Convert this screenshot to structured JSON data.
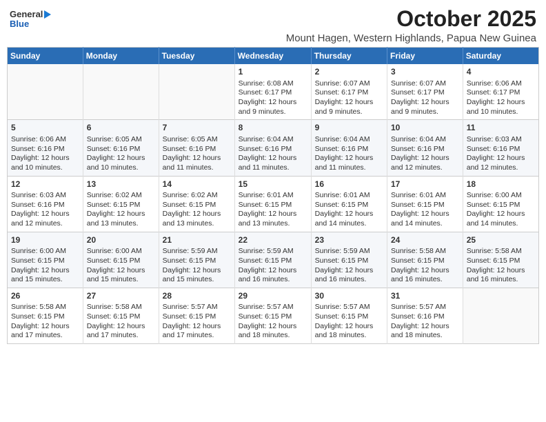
{
  "header": {
    "logo_line1": "General",
    "logo_line2": "Blue",
    "title": "October 2025",
    "subtitle": "Mount Hagen, Western Highlands, Papua New Guinea"
  },
  "weekdays": [
    "Sunday",
    "Monday",
    "Tuesday",
    "Wednesday",
    "Thursday",
    "Friday",
    "Saturday"
  ],
  "rows": [
    [
      {
        "day": "",
        "info": ""
      },
      {
        "day": "",
        "info": ""
      },
      {
        "day": "",
        "info": ""
      },
      {
        "day": "1",
        "info": "Sunrise: 6:08 AM\nSunset: 6:17 PM\nDaylight: 12 hours and 9 minutes."
      },
      {
        "day": "2",
        "info": "Sunrise: 6:07 AM\nSunset: 6:17 PM\nDaylight: 12 hours and 9 minutes."
      },
      {
        "day": "3",
        "info": "Sunrise: 6:07 AM\nSunset: 6:17 PM\nDaylight: 12 hours and 9 minutes."
      },
      {
        "day": "4",
        "info": "Sunrise: 6:06 AM\nSunset: 6:17 PM\nDaylight: 12 hours and 10 minutes."
      }
    ],
    [
      {
        "day": "5",
        "info": "Sunrise: 6:06 AM\nSunset: 6:16 PM\nDaylight: 12 hours and 10 minutes."
      },
      {
        "day": "6",
        "info": "Sunrise: 6:05 AM\nSunset: 6:16 PM\nDaylight: 12 hours and 10 minutes."
      },
      {
        "day": "7",
        "info": "Sunrise: 6:05 AM\nSunset: 6:16 PM\nDaylight: 12 hours and 11 minutes."
      },
      {
        "day": "8",
        "info": "Sunrise: 6:04 AM\nSunset: 6:16 PM\nDaylight: 12 hours and 11 minutes."
      },
      {
        "day": "9",
        "info": "Sunrise: 6:04 AM\nSunset: 6:16 PM\nDaylight: 12 hours and 11 minutes."
      },
      {
        "day": "10",
        "info": "Sunrise: 6:04 AM\nSunset: 6:16 PM\nDaylight: 12 hours and 12 minutes."
      },
      {
        "day": "11",
        "info": "Sunrise: 6:03 AM\nSunset: 6:16 PM\nDaylight: 12 hours and 12 minutes."
      }
    ],
    [
      {
        "day": "12",
        "info": "Sunrise: 6:03 AM\nSunset: 6:16 PM\nDaylight: 12 hours and 12 minutes."
      },
      {
        "day": "13",
        "info": "Sunrise: 6:02 AM\nSunset: 6:15 PM\nDaylight: 12 hours and 13 minutes."
      },
      {
        "day": "14",
        "info": "Sunrise: 6:02 AM\nSunset: 6:15 PM\nDaylight: 12 hours and 13 minutes."
      },
      {
        "day": "15",
        "info": "Sunrise: 6:01 AM\nSunset: 6:15 PM\nDaylight: 12 hours and 13 minutes."
      },
      {
        "day": "16",
        "info": "Sunrise: 6:01 AM\nSunset: 6:15 PM\nDaylight: 12 hours and 14 minutes."
      },
      {
        "day": "17",
        "info": "Sunrise: 6:01 AM\nSunset: 6:15 PM\nDaylight: 12 hours and 14 minutes."
      },
      {
        "day": "18",
        "info": "Sunrise: 6:00 AM\nSunset: 6:15 PM\nDaylight: 12 hours and 14 minutes."
      }
    ],
    [
      {
        "day": "19",
        "info": "Sunrise: 6:00 AM\nSunset: 6:15 PM\nDaylight: 12 hours and 15 minutes."
      },
      {
        "day": "20",
        "info": "Sunrise: 6:00 AM\nSunset: 6:15 PM\nDaylight: 12 hours and 15 minutes."
      },
      {
        "day": "21",
        "info": "Sunrise: 5:59 AM\nSunset: 6:15 PM\nDaylight: 12 hours and 15 minutes."
      },
      {
        "day": "22",
        "info": "Sunrise: 5:59 AM\nSunset: 6:15 PM\nDaylight: 12 hours and 16 minutes."
      },
      {
        "day": "23",
        "info": "Sunrise: 5:59 AM\nSunset: 6:15 PM\nDaylight: 12 hours and 16 minutes."
      },
      {
        "day": "24",
        "info": "Sunrise: 5:58 AM\nSunset: 6:15 PM\nDaylight: 12 hours and 16 minutes."
      },
      {
        "day": "25",
        "info": "Sunrise: 5:58 AM\nSunset: 6:15 PM\nDaylight: 12 hours and 16 minutes."
      }
    ],
    [
      {
        "day": "26",
        "info": "Sunrise: 5:58 AM\nSunset: 6:15 PM\nDaylight: 12 hours and 17 minutes."
      },
      {
        "day": "27",
        "info": "Sunrise: 5:58 AM\nSunset: 6:15 PM\nDaylight: 12 hours and 17 minutes."
      },
      {
        "day": "28",
        "info": "Sunrise: 5:57 AM\nSunset: 6:15 PM\nDaylight: 12 hours and 17 minutes."
      },
      {
        "day": "29",
        "info": "Sunrise: 5:57 AM\nSunset: 6:15 PM\nDaylight: 12 hours and 18 minutes."
      },
      {
        "day": "30",
        "info": "Sunrise: 5:57 AM\nSunset: 6:15 PM\nDaylight: 12 hours and 18 minutes."
      },
      {
        "day": "31",
        "info": "Sunrise: 5:57 AM\nSunset: 6:16 PM\nDaylight: 12 hours and 18 minutes."
      },
      {
        "day": "",
        "info": ""
      }
    ]
  ]
}
